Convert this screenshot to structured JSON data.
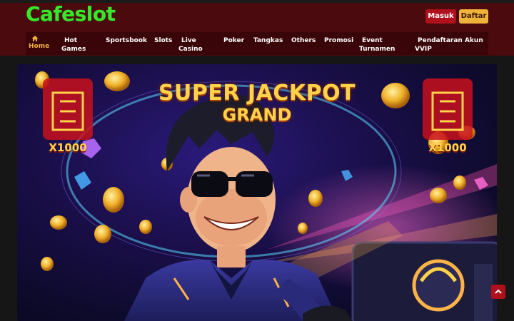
{
  "brand": {
    "logo_text": "Cafeslot",
    "logo_color": "#39e62a"
  },
  "header": {
    "login_label": "Masuk",
    "register_label": "Daftar"
  },
  "nav": {
    "items": [
      {
        "label": "Home",
        "icon": "home-icon",
        "active": true
      },
      {
        "label": "Hot Games"
      },
      {
        "label": "Sportsbook"
      },
      {
        "label": "Slots"
      },
      {
        "label": "Live Casino"
      },
      {
        "label": "Poker"
      },
      {
        "label": "Tangkas"
      },
      {
        "label": "Others"
      },
      {
        "label": "Promosi"
      },
      {
        "label": "Event Turnamen"
      },
      {
        "label": "Pendaftaran Akun VVIP"
      }
    ]
  },
  "hero": {
    "line1": "SUPER JACKPOT",
    "line2": "GRAND",
    "multiplier_left": "X1000",
    "multiplier_right": "X1000"
  },
  "colors": {
    "header_bg": "#4a0a0e",
    "accent_red": "#b0101c",
    "accent_gold": "#f0b33a"
  },
  "scroll_top_icon": "chevron-up-icon"
}
